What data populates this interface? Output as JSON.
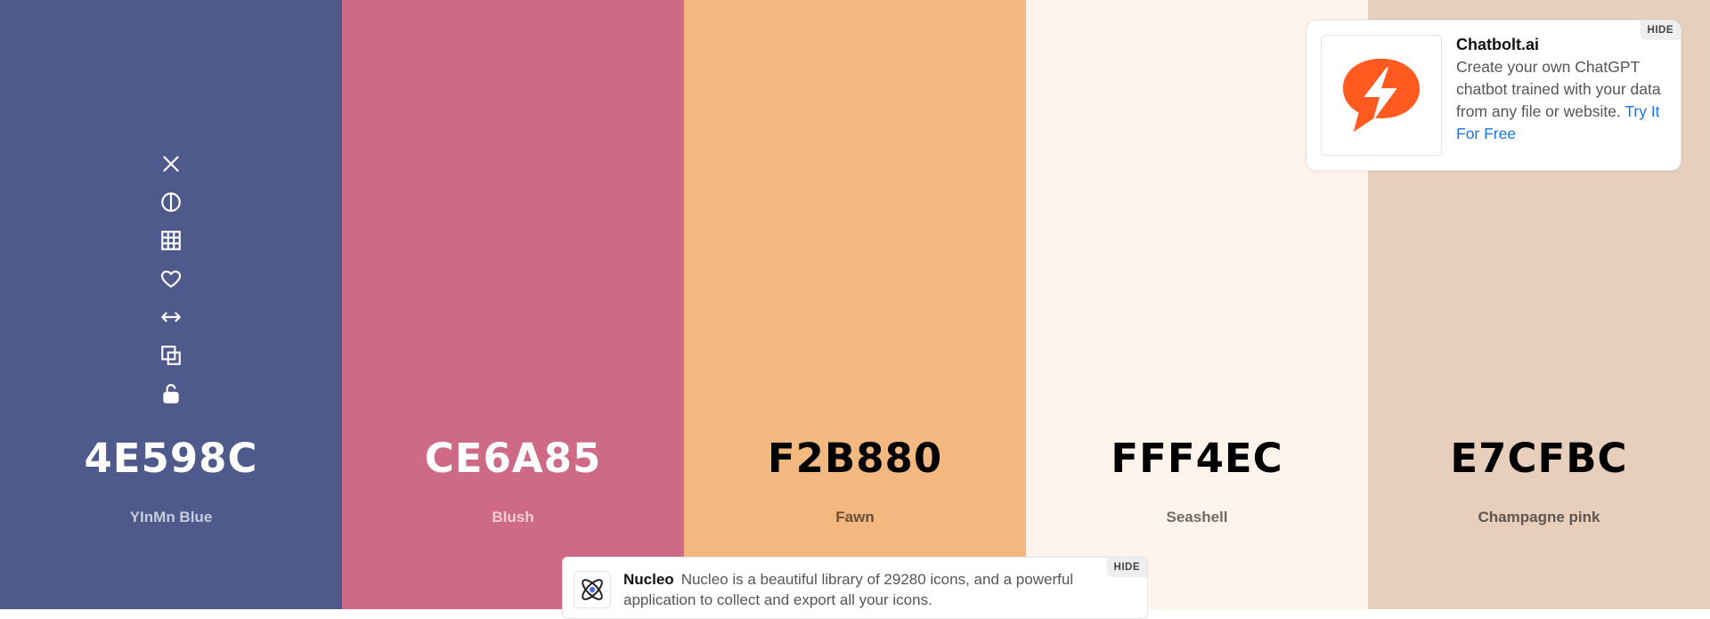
{
  "palette": {
    "colors": [
      {
        "hex": "4E598C",
        "name": "YInMn Blue",
        "bg": "#4E598C",
        "hex_color": "#FFFFFF",
        "name_color": "#C9CCDA"
      },
      {
        "hex": "CE6A85",
        "name": "Blush",
        "bg": "#CE6A85",
        "hex_color": "#FFFFFF",
        "name_color": "#F0CDD7"
      },
      {
        "hex": "F2B880",
        "name": "Fawn",
        "bg": "#F2B880",
        "hex_color": "#000000",
        "name_color": "#6B5038"
      },
      {
        "hex": "FFF4EC",
        "name": "Seashell",
        "bg": "#FFF4EC",
        "hex_color": "#000000",
        "name_color": "#6E6A66"
      },
      {
        "hex": "E7CFBC",
        "name": "Champagne pink",
        "bg": "#E7CFBC",
        "hex_color": "#000000",
        "name_color": "#5E5650"
      }
    ],
    "tools": [
      "close-icon",
      "contrast-icon",
      "grid-icon",
      "heart-icon",
      "arrows-horizontal-icon",
      "copy-icon",
      "unlock-icon"
    ]
  },
  "ad_top": {
    "title": "Chatbolt.ai",
    "text": "Create your own ChatGPT chatbot trained with your data from any file or website.",
    "cta": "Try It For Free",
    "hide_label": "HIDE",
    "logo_color": "#FF5A1F"
  },
  "ad_bottom": {
    "brand": "Nucleo",
    "text": "Nucleo is a beautiful library of 29280 icons, and a powerful application to collect and export all your icons.",
    "hide_label": "HIDE"
  }
}
